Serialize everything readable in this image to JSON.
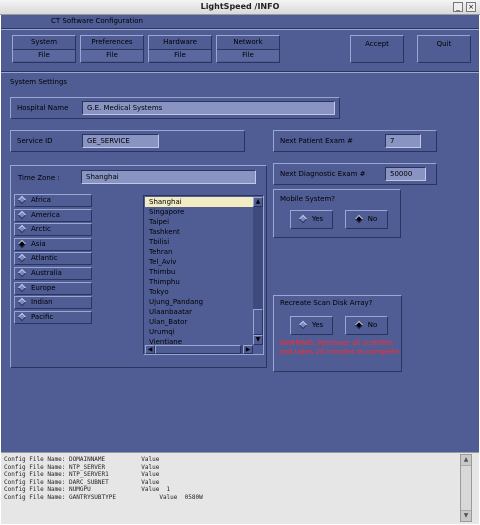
{
  "window": {
    "title": "LightSpeed /INFO",
    "min_icon": "minimize-icon",
    "close_icon": "close-icon"
  },
  "app": {
    "header": "CT Software Configuration",
    "colors": {
      "background": "#4f5d94",
      "field": "#8a94c3",
      "selected": "#f1ecc1",
      "warning": "#ff2a2a"
    },
    "top_buttons": [
      {
        "label": "System",
        "sub": "File"
      },
      {
        "label": "Preferences",
        "sub": "File"
      },
      {
        "label": "Hardware",
        "sub": "File"
      },
      {
        "label": "Network",
        "sub": "File"
      }
    ],
    "accept": "Accept",
    "quit": "Quit",
    "section_title": "System Settings",
    "hospital_name": {
      "label": "Hospital Name",
      "value": "G.E. Medical Systems"
    },
    "service_id": {
      "label": "Service ID",
      "value": "GE_SERVICE"
    },
    "next_patient": {
      "label": "Next Patient Exam #",
      "value": "7"
    },
    "next_diag": {
      "label": "Next Diagnostic Exam #",
      "value": "50000"
    },
    "timezone": {
      "label": "Time Zone :",
      "value": "Shanghai"
    },
    "regions": [
      "Africa",
      "America",
      "Arctic",
      "Asia",
      "Atlantic",
      "Australia",
      "Europe",
      "Indian",
      "Pacific"
    ],
    "selected_region": "Asia",
    "cities": [
      "Shanghai",
      "Singapore",
      "Taipei",
      "Tashkent",
      "Tbilisi",
      "Tehran",
      "Tel_Aviv",
      "Thimbu",
      "Thimphu",
      "Tokyo",
      "Ujung_Pandang",
      "Ulaanbaatar",
      "Ulan_Bator",
      "Urumqi",
      "Vientiane"
    ],
    "selected_city": "Shanghai",
    "mobile": {
      "title": "Mobile System?",
      "yes": "Yes",
      "no": "No",
      "selected": "No"
    },
    "scan": {
      "title": "Recreate Scan Disk Array?",
      "yes": "Yes",
      "no": "No",
      "selected": "No",
      "warning_line1": "WARNING: Removes all scanfiles",
      "warning_line2": "and takes 20 minutes to complete"
    }
  },
  "console": {
    "lines": [
      "Config File Name: DOMAINNAME          Value",
      "Config File Name: NTP_SERVER          Value",
      "Config File Name: NTP_SERVER1         Value",
      "Config File Name: DARC_SUBNET         Value",
      "Config File Name: NUMGPU              Value  1",
      "Config File Name: GANTRYSUBTYPE            Value  0580W"
    ]
  }
}
